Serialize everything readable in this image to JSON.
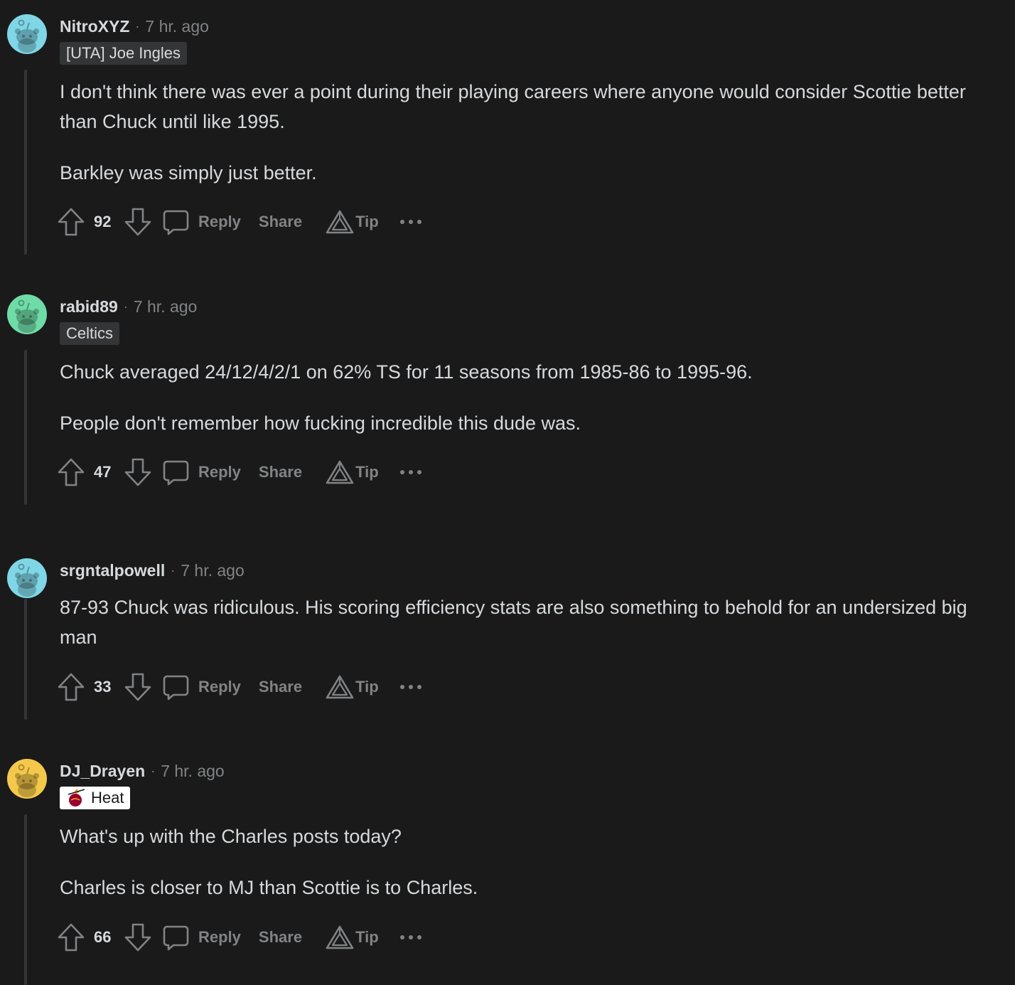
{
  "colors": {
    "background": "#1a1a1b",
    "text": "#d7dadc",
    "muted": "#818384",
    "flair_bg": "#343536",
    "thread_line": "#343536"
  },
  "actions": {
    "reply_label": "Reply",
    "share_label": "Share",
    "tip_label": "Tip",
    "upvote_icon": "arrow-up-icon",
    "downvote_icon": "arrow-down-icon",
    "reply_icon": "speech-bubble-icon",
    "tip_icon": "triangle-icon",
    "more_icon": "ellipsis-icon"
  },
  "comments": [
    {
      "username": "NitroXYZ",
      "separator": "·",
      "time": "7 hr. ago",
      "flair": "[UTA] Joe Ingles",
      "avatar_color": "#7fd6e6",
      "paragraphs": [
        "I don't think there was ever a point during their playing careers where anyone would consider Scottie better than Chuck until like 1995.",
        "Barkley was simply just better."
      ],
      "score": "92"
    },
    {
      "username": "rabid89",
      "separator": "·",
      "time": "7 hr. ago",
      "flair": "Celtics",
      "avatar_color": "#6fdba7",
      "paragraphs": [
        "Chuck averaged 24/12/4/2/1 on 62% TS for 11 seasons from 1985-86 to 1995-96.",
        "People don't remember how fucking incredible this dude was."
      ],
      "score": "47"
    },
    {
      "username": "srgntalpowell",
      "separator": "·",
      "time": "7 hr. ago",
      "flair": "",
      "avatar_color": "#7fd6e6",
      "paragraphs": [
        "87-93 Chuck was ridiculous. His scoring efficiency stats are also something to behold for an undersized big man"
      ],
      "score": "33"
    },
    {
      "username": "DJ_Drayen",
      "separator": "·",
      "time": "7 hr. ago",
      "flair": "Heat",
      "flair_icon": "heat-logo-icon",
      "avatar_color": "#f4c84a",
      "paragraphs": [
        "What's up with the Charles posts today?",
        "Charles is closer to MJ than Scottie is to Charles."
      ],
      "score": "66"
    }
  ]
}
